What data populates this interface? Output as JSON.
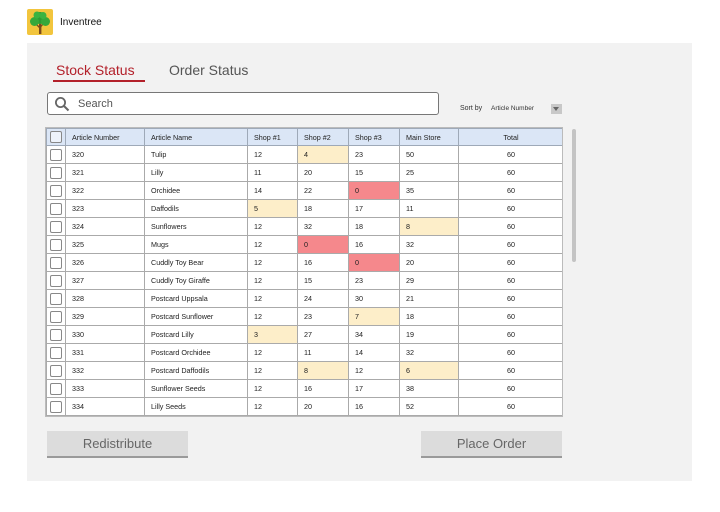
{
  "app": {
    "title": "Inventree",
    "logo_icon": "tree-icon"
  },
  "tabs": [
    {
      "label": "Stock Status",
      "active": true
    },
    {
      "label": "Order Status",
      "active": false
    }
  ],
  "search": {
    "placeholder": "Search",
    "value": ""
  },
  "sort": {
    "label": "Sort by",
    "value": "Article Number"
  },
  "table": {
    "columns": [
      "Article Number",
      "Article Name",
      "Shop #1",
      "Shop #2",
      "Shop #3",
      "Main Store",
      "Total"
    ],
    "rows": [
      {
        "cells": [
          "320",
          "Tulip",
          "12",
          "4",
          "23",
          "50",
          "60"
        ],
        "status": [
          "",
          "",
          "",
          "warn",
          "",
          "",
          ""
        ]
      },
      {
        "cells": [
          "321",
          "Lilly",
          "11",
          "20",
          "15",
          "25",
          "60"
        ],
        "status": [
          "",
          "",
          "",
          "",
          "",
          "",
          ""
        ]
      },
      {
        "cells": [
          "322",
          "Orchidee",
          "14",
          "22",
          "0",
          "35",
          "60"
        ],
        "status": [
          "",
          "",
          "",
          "",
          "crit",
          "",
          ""
        ]
      },
      {
        "cells": [
          "323",
          "Daffodils",
          "5",
          "18",
          "17",
          "11",
          "60"
        ],
        "status": [
          "",
          "",
          "warn",
          "",
          "",
          "",
          ""
        ]
      },
      {
        "cells": [
          "324",
          "Sunflowers",
          "12",
          "32",
          "18",
          "8",
          "60"
        ],
        "status": [
          "",
          "",
          "",
          "",
          "",
          "warn",
          ""
        ]
      },
      {
        "cells": [
          "325",
          "Mugs",
          "12",
          "0",
          "16",
          "32",
          "60"
        ],
        "status": [
          "",
          "",
          "",
          "crit",
          "",
          "",
          ""
        ]
      },
      {
        "cells": [
          "326",
          "Cuddly Toy Bear",
          "12",
          "16",
          "0",
          "20",
          "60"
        ],
        "status": [
          "",
          "",
          "",
          "",
          "crit",
          "",
          ""
        ]
      },
      {
        "cells": [
          "327",
          "Cuddly Toy Giraffe",
          "12",
          "15",
          "23",
          "29",
          "60"
        ],
        "status": [
          "",
          "",
          "",
          "",
          "",
          "",
          ""
        ]
      },
      {
        "cells": [
          "328",
          "Postcard Uppsala",
          "12",
          "24",
          "30",
          "21",
          "60"
        ],
        "status": [
          "",
          "",
          "",
          "",
          "",
          "",
          ""
        ]
      },
      {
        "cells": [
          "329",
          "Postcard Sunflower",
          "12",
          "23",
          "7",
          "18",
          "60"
        ],
        "status": [
          "",
          "",
          "",
          "",
          "warn",
          "",
          ""
        ]
      },
      {
        "cells": [
          "330",
          "Postcard Lilly",
          "3",
          "27",
          "34",
          "19",
          "60"
        ],
        "status": [
          "",
          "",
          "warn",
          "",
          "",
          "",
          ""
        ]
      },
      {
        "cells": [
          "331",
          "Postcard Orchidee",
          "12",
          "11",
          "14",
          "32",
          "60"
        ],
        "status": [
          "",
          "",
          "",
          "",
          "",
          "",
          ""
        ]
      },
      {
        "cells": [
          "332",
          "Postcard Daffodils",
          "12",
          "8",
          "12",
          "6",
          "60"
        ],
        "status": [
          "",
          "",
          "",
          "warn",
          "",
          "warn",
          ""
        ]
      },
      {
        "cells": [
          "333",
          "Sunflower Seeds",
          "12",
          "16",
          "17",
          "38",
          "60"
        ],
        "status": [
          "",
          "",
          "",
          "",
          "",
          "",
          ""
        ]
      },
      {
        "cells": [
          "334",
          "Lilly Seeds",
          "12",
          "20",
          "16",
          "52",
          "60"
        ],
        "status": [
          "",
          "",
          "",
          "",
          "",
          "",
          ""
        ]
      }
    ]
  },
  "actions": {
    "redistribute_label": "Redistribute",
    "place_order_label": "Place Order"
  },
  "colors": {
    "accent": "#b3202a",
    "warn": "#fdeec9",
    "critical": "#f5888c",
    "header": "#dbe6f6",
    "logo_bg": "#f2c53d"
  }
}
